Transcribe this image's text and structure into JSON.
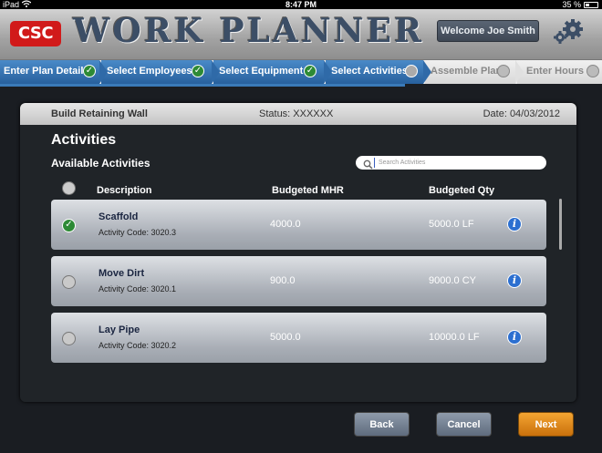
{
  "status_bar": {
    "device": "iPad",
    "time": "8:47 PM",
    "battery": "35 %"
  },
  "header": {
    "logo": "CSC",
    "title": "WORK PLANNER",
    "welcome": "Welcome Joe Smith"
  },
  "steps": [
    {
      "label": "Enter Plan Detail",
      "state": "done"
    },
    {
      "label": "Select Employees",
      "state": "done"
    },
    {
      "label": "Select Equipment",
      "state": "done"
    },
    {
      "label": "Select Activities",
      "state": "current"
    },
    {
      "label": "Assemble Plan",
      "state": "pending"
    },
    {
      "label": "Enter Hours",
      "state": "pending"
    }
  ],
  "plan": {
    "name": "Build Retaining Wall",
    "status": "Status: XXXXXX",
    "date": "Date: 04/03/2012"
  },
  "activities": {
    "title": "Activities",
    "available_label": "Available Activities",
    "search_placeholder": "Search Activities",
    "columns": {
      "description": "Description",
      "mhr": "Budgeted MHR",
      "qty": "Budgeted Qty"
    },
    "rows": [
      {
        "description": "Scaffold",
        "code": "Activity Code: 3020.3",
        "mhr": "4000.0",
        "qty": "5000.0 LF",
        "selected": true
      },
      {
        "description": "Move Dirt",
        "code": "Activity Code: 3020.1",
        "mhr": "900.0",
        "qty": "9000.0 CY",
        "selected": false
      },
      {
        "description": "Lay Pipe",
        "code": "Activity Code: 3020.2",
        "mhr": "5000.0",
        "qty": "10000.0 LF",
        "selected": false
      }
    ]
  },
  "buttons": {
    "back": "Back",
    "cancel": "Cancel",
    "next": "Next"
  },
  "colors": {
    "accent_blue": "#27609d",
    "check_green": "#2d8a35",
    "next_orange": "#e08a1a",
    "brand_red": "#d11a1a"
  }
}
